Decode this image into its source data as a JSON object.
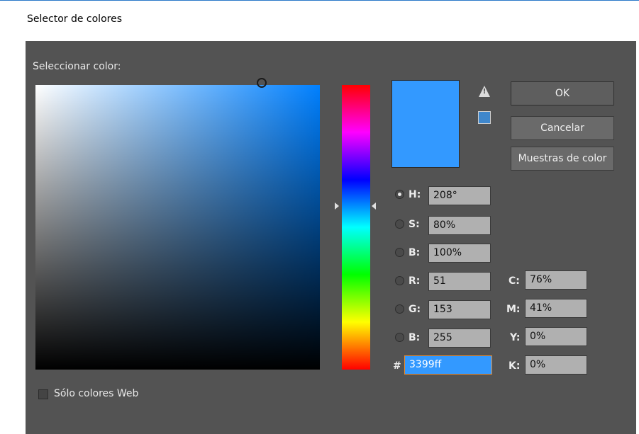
{
  "window": {
    "title": "Selector de colores"
  },
  "picker": {
    "label": "Seleccionar color:"
  },
  "swatch": {
    "color": "#3399ff",
    "websafe_color": "#3f87cc",
    "warning_icon": "warning-triangle-icon"
  },
  "buttons": {
    "ok": "OK",
    "cancel": "Cancelar",
    "swatches": "Muestras de color"
  },
  "hsb": {
    "h": {
      "label": "H:",
      "value": "208°",
      "selected": true
    },
    "s": {
      "label": "S:",
      "value": "80%"
    },
    "b": {
      "label": "B:",
      "value": "100%"
    }
  },
  "rgb": {
    "r": {
      "label": "R:",
      "value": "51"
    },
    "g": {
      "label": "G:",
      "value": "153"
    },
    "b": {
      "label": "B:",
      "value": "255"
    }
  },
  "hex": {
    "label": "#",
    "value": "3399ff"
  },
  "cmyk": {
    "c": {
      "label": "C:",
      "value": "76%"
    },
    "m": {
      "label": "M:",
      "value": "41%"
    },
    "y": {
      "label": "Y:",
      "value": "0%"
    },
    "k": {
      "label": "K:",
      "value": "0%"
    }
  },
  "web_only": {
    "label": "Sólo colores Web",
    "checked": false
  }
}
